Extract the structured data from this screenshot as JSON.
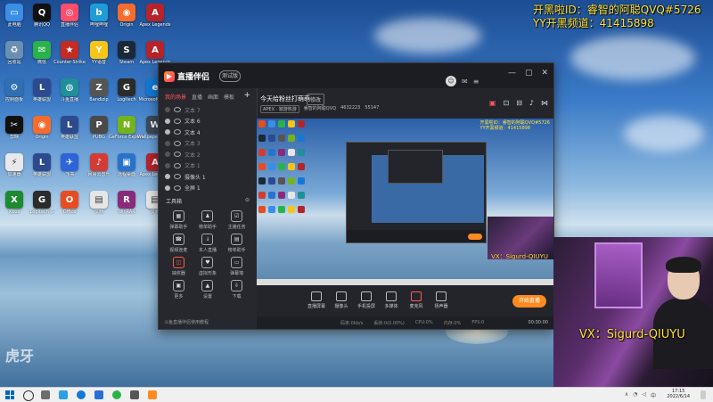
{
  "overlay": {
    "line1": "开黑啦ID：睿智的阿聪QVQ#5726",
    "line2": "YY开黑频道：41415898",
    "watermark": "虎牙",
    "cam_vx": "VX：Sigurd-QIUYU"
  },
  "desktop_icons": [
    {
      "label": "此电脑",
      "color": "#3a8ee6",
      "glyph": "▭"
    },
    {
      "label": "腾讯QQ",
      "color": "#111111",
      "glyph": "Q"
    },
    {
      "label": "直播伴侣",
      "color": "#ff4d6d",
      "glyph": "◎"
    },
    {
      "label": "哔哩哔哩",
      "color": "#1f9bd7",
      "glyph": "b"
    },
    {
      "label": "Origin",
      "color": "#f56c2d",
      "glyph": "◉"
    },
    {
      "label": "Apex Legends",
      "color": "#b5242a",
      "glyph": "A"
    },
    {
      "label": "回收站",
      "color": "#6b8fb3",
      "glyph": "♻"
    },
    {
      "label": "微信",
      "color": "#29b34a",
      "glyph": "✉"
    },
    {
      "label": "Counter-Strike",
      "color": "#c42b22",
      "glyph": "★"
    },
    {
      "label": "YY语音",
      "color": "#f5c518",
      "glyph": "Y"
    },
    {
      "label": "Steam",
      "color": "#1b2838",
      "glyph": "S"
    },
    {
      "label": "Apex Legends",
      "color": "#b5242a",
      "glyph": "A"
    },
    {
      "label": "控制面板",
      "color": "#2f6fb4",
      "glyph": "⚙"
    },
    {
      "label": "英雄联盟",
      "color": "#2d4a8f",
      "glyph": "L"
    },
    {
      "label": "斗鱼直播",
      "color": "#1f8f9a",
      "glyph": "◍"
    },
    {
      "label": "Bandizip",
      "color": "#555555",
      "glyph": "Z"
    },
    {
      "label": "Logitech",
      "color": "#2b2b2b",
      "glyph": "G"
    },
    {
      "label": "Microsoft Edge",
      "color": "#1379d6",
      "glyph": "e"
    },
    {
      "label": "剪映",
      "color": "#111111",
      "glyph": "✂"
    },
    {
      "label": "Origin",
      "color": "#f56c2d",
      "glyph": "◉"
    },
    {
      "label": "英雄联盟",
      "color": "#2d4a8f",
      "glyph": "L"
    },
    {
      "label": "PUBG",
      "color": "#4a4a4a",
      "glyph": "P"
    },
    {
      "label": "GeForce Experience",
      "color": "#73b41c",
      "glyph": "N"
    },
    {
      "label": "Wallpaper Engine",
      "color": "#3c4a5a",
      "glyph": "W"
    },
    {
      "label": "加速器",
      "color": "#e9e9e9",
      "glyph": "⚡"
    },
    {
      "label": "英雄联盟",
      "color": "#2d4a8f",
      "glyph": "L"
    },
    {
      "label": "飞书",
      "color": "#2d64d8",
      "glyph": "✈"
    },
    {
      "label": "网易云音乐",
      "color": "#d43c33",
      "glyph": "♪"
    },
    {
      "label": "远程桌面",
      "color": "#2873c9",
      "glyph": "▣"
    },
    {
      "label": "Apex Legends",
      "color": "#b5242a",
      "glyph": "A"
    },
    {
      "label": "Xbox",
      "color": "#1c8a2f",
      "glyph": "X"
    },
    {
      "label": "Logitech G",
      "color": "#2b2b2b",
      "glyph": "G"
    },
    {
      "label": "Office",
      "color": "#e84c22",
      "glyph": "O"
    },
    {
      "label": "文档",
      "color": "#e6e6e6",
      "glyph": "▤"
    },
    {
      "label": "WinRAR",
      "color": "#8a2a7a",
      "glyph": "R"
    },
    {
      "label": "文档",
      "color": "#e6e6e6",
      "glyph": "▤"
    }
  ],
  "app": {
    "name": "直播伴侣",
    "badge": "测试版",
    "left_tabs": [
      "我的场景",
      "直播",
      "画面",
      "模板"
    ],
    "scenes": [
      {
        "label": "文本 7",
        "visible": false
      },
      {
        "label": "文本 6",
        "visible": true
      },
      {
        "label": "文本 4",
        "visible": true
      },
      {
        "label": "文本 3",
        "visible": false
      },
      {
        "label": "文本 2",
        "visible": false
      },
      {
        "label": "文本 1",
        "visible": false
      },
      {
        "label": "摄像头 1",
        "visible": true
      },
      {
        "label": "全屏 1",
        "visible": true
      }
    ],
    "tools_header": "工具箱",
    "tools": [
      {
        "label": "弹幕助手",
        "glyph": "▦",
        "hl": false
      },
      {
        "label": "榜单助手",
        "glyph": "♟",
        "hl": false
      },
      {
        "label": "主播任务",
        "glyph": "☑",
        "hl": false
      },
      {
        "label": "视频连麦",
        "glyph": "☎",
        "hl": false
      },
      {
        "label": "本人直播",
        "glyph": "↓",
        "hl": false
      },
      {
        "label": "榜单助手",
        "glyph": "▤",
        "hl": false
      },
      {
        "label": "抽奖器",
        "glyph": "◫",
        "hl": true
      },
      {
        "label": "虚拟形象",
        "glyph": "♥",
        "hl": false
      },
      {
        "label": "弹幕墙",
        "glyph": "▭",
        "hl": false
      },
      {
        "label": "更多",
        "glyph": "▣",
        "hl": false
      },
      {
        "label": "设置",
        "glyph": "▲",
        "hl": false
      },
      {
        "label": "下载",
        "glyph": "⇩",
        "hl": false
      }
    ],
    "left_footer": "斗鱼直播伴侣使用教程",
    "stream_title": "今天给粉丝打萌萌",
    "stream_tag": "修改",
    "stream_sub": [
      "APEX · 端游热游",
      "睿智的阿聪QVQ",
      "4632223",
      "55147"
    ],
    "ctrl_items": [
      "直播屏幕",
      "摄像头",
      "手机投屏",
      "多媒体",
      "麦克风",
      "扬声器"
    ],
    "start_button": "开始直播",
    "status_items": [
      "码率:0kb/s",
      "丢帧:0(0.00%)",
      "CPU:0%",
      "内存:0%",
      "FPS:0"
    ],
    "rec_time": "00:00:00",
    "preview_text1": "开黑啦ID：睿智的阿聪QVQ#5726",
    "preview_text2": "YY开黑频道：41415898",
    "preview_vx": "VX：Sigurd-QIUYU"
  },
  "taskbar": {
    "time": "17:15",
    "date": "2022/6/14"
  }
}
